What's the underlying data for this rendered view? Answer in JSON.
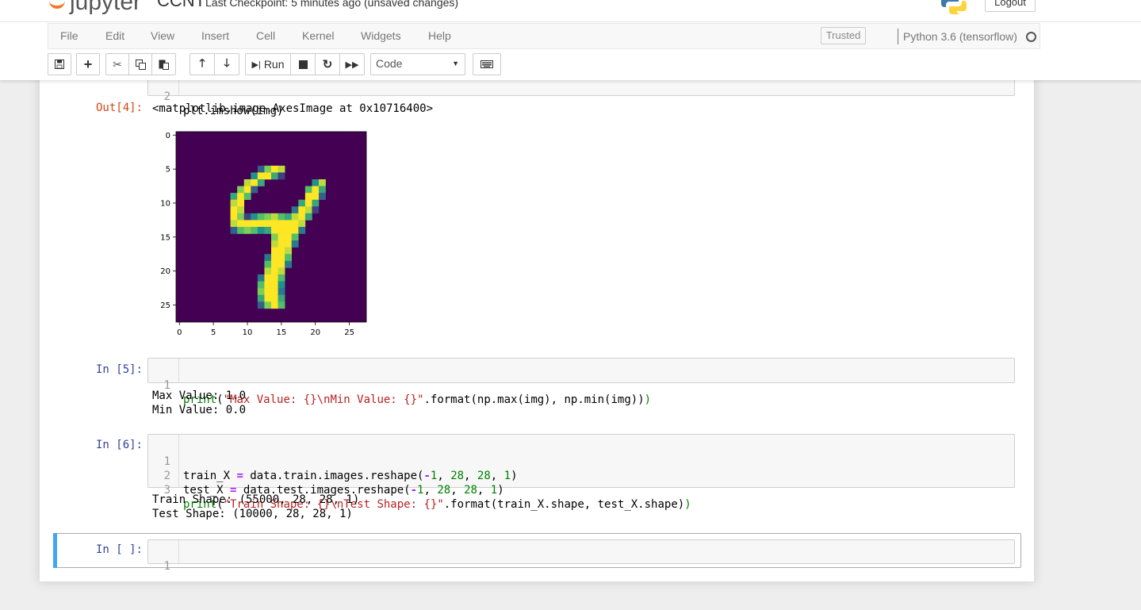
{
  "header": {
    "logo_text": "jupyter",
    "notebook_name": "CCNT",
    "checkpoint": "Last Checkpoint: 5 minutes ago  (unsaved changes)",
    "logout_label": "Logout"
  },
  "menu": {
    "items": [
      "File",
      "Edit",
      "View",
      "Insert",
      "Cell",
      "Kernel",
      "Widgets",
      "Help"
    ],
    "trusted_label": "Trusted",
    "kernel_name": "Python 3.6 (tensorflow)"
  },
  "toolbar": {
    "run_label": "Run",
    "cell_type": "Code",
    "icons": [
      "save-icon",
      "plus-icon",
      "cut-icon",
      "copy-icon",
      "paste-icon",
      "arrow-up-icon",
      "arrow-down-icon",
      "run-icon",
      "stop-icon",
      "restart-icon",
      "fast-forward-icon",
      "keyboard-icon"
    ]
  },
  "cells": {
    "c4": {
      "line2_num": "2",
      "line2_code": "plt.imshow(img)",
      "out_prompt": "Out[4]:",
      "out_text": "<matplotlib.image.AxesImage at 0x10716400>"
    },
    "c5": {
      "prompt": "In [5]:",
      "line1_num": "1",
      "output_line1": "Max Value: 1.0",
      "output_line2": "Min Value: 0.0"
    },
    "c6": {
      "prompt": "In [6]:",
      "line_nums": [
        "1",
        "2",
        "3"
      ],
      "output_line1": "Train Shape: (55000, 28, 28, 1)",
      "output_line2": "Test Shape: (10000, 28, 28, 1)"
    },
    "c7": {
      "prompt": "In [ ]:",
      "line1_num": "1"
    }
  },
  "chart_data": {
    "type": "heatmap",
    "title": "",
    "xlabel": "",
    "ylabel": "",
    "x_ticks": [
      "0",
      "5",
      "10",
      "15",
      "20",
      "25"
    ],
    "y_ticks": [
      "0",
      "5",
      "10",
      "15",
      "20",
      "25"
    ],
    "xlim": [
      -0.5,
      27.5
    ],
    "ylim": [
      27.5,
      -0.5
    ],
    "colormap": "viridis",
    "background_color": "#440154",
    "vmin": 0.0,
    "vmax": 1.0,
    "description_of_values": "28x28 grayscale MNIST digit 4; nonzero pixels listed as [row, col, value]",
    "pixels": [
      [
        5,
        12,
        0.3
      ],
      [
        5,
        13,
        0.8
      ],
      [
        5,
        14,
        1.0
      ],
      [
        5,
        15,
        0.9
      ],
      [
        6,
        11,
        0.5
      ],
      [
        6,
        12,
        1.0
      ],
      [
        6,
        13,
        1.0
      ],
      [
        6,
        14,
        0.6
      ],
      [
        6,
        15,
        0.2
      ],
      [
        7,
        10,
        0.9
      ],
      [
        7,
        11,
        1.0
      ],
      [
        7,
        12,
        0.6
      ],
      [
        7,
        20,
        0.5
      ],
      [
        7,
        21,
        0.9
      ],
      [
        8,
        9,
        0.8
      ],
      [
        8,
        10,
        1.0
      ],
      [
        8,
        11,
        0.3
      ],
      [
        8,
        19,
        0.7
      ],
      [
        8,
        20,
        1.0
      ],
      [
        8,
        21,
        0.6
      ],
      [
        9,
        8,
        0.6
      ],
      [
        9,
        9,
        1.0
      ],
      [
        9,
        10,
        0.7
      ],
      [
        9,
        19,
        1.0
      ],
      [
        9,
        20,
        1.0
      ],
      [
        9,
        21,
        0.3
      ],
      [
        10,
        8,
        0.9
      ],
      [
        10,
        9,
        1.0
      ],
      [
        10,
        18,
        0.6
      ],
      [
        10,
        19,
        1.0
      ],
      [
        10,
        20,
        0.6
      ],
      [
        11,
        8,
        1.0
      ],
      [
        11,
        9,
        0.9
      ],
      [
        11,
        17,
        0.4
      ],
      [
        11,
        18,
        1.0
      ],
      [
        11,
        19,
        0.9
      ],
      [
        11,
        20,
        0.2
      ],
      [
        12,
        8,
        1.0
      ],
      [
        12,
        9,
        0.8
      ],
      [
        12,
        10,
        0.2
      ],
      [
        12,
        11,
        0.5
      ],
      [
        12,
        12,
        0.7
      ],
      [
        12,
        13,
        0.8
      ],
      [
        12,
        14,
        0.9
      ],
      [
        12,
        15,
        0.7
      ],
      [
        12,
        16,
        0.6
      ],
      [
        12,
        17,
        0.9
      ],
      [
        12,
        18,
        1.0
      ],
      [
        12,
        19,
        0.6
      ],
      [
        13,
        8,
        0.9
      ],
      [
        13,
        9,
        1.0
      ],
      [
        13,
        10,
        1.0
      ],
      [
        13,
        11,
        1.0
      ],
      [
        13,
        12,
        1.0
      ],
      [
        13,
        13,
        1.0
      ],
      [
        13,
        14,
        1.0
      ],
      [
        13,
        15,
        1.0
      ],
      [
        13,
        16,
        1.0
      ],
      [
        13,
        17,
        1.0
      ],
      [
        13,
        18,
        0.9
      ],
      [
        14,
        8,
        0.3
      ],
      [
        14,
        9,
        0.7
      ],
      [
        14,
        10,
        0.8
      ],
      [
        14,
        11,
        0.7
      ],
      [
        14,
        12,
        0.5
      ],
      [
        14,
        13,
        0.6
      ],
      [
        14,
        14,
        1.0
      ],
      [
        14,
        15,
        1.0
      ],
      [
        14,
        16,
        1.0
      ],
      [
        14,
        17,
        1.0
      ],
      [
        14,
        18,
        0.4
      ],
      [
        15,
        14,
        0.8
      ],
      [
        15,
        15,
        1.0
      ],
      [
        15,
        16,
        1.0
      ],
      [
        15,
        17,
        0.7
      ],
      [
        16,
        14,
        0.9
      ],
      [
        16,
        15,
        1.0
      ],
      [
        16,
        16,
        1.0
      ],
      [
        16,
        17,
        0.4
      ],
      [
        17,
        14,
        1.0
      ],
      [
        17,
        15,
        1.0
      ],
      [
        17,
        16,
        0.9
      ],
      [
        18,
        13,
        0.4
      ],
      [
        18,
        14,
        1.0
      ],
      [
        18,
        15,
        1.0
      ],
      [
        18,
        16,
        0.7
      ],
      [
        19,
        13,
        0.7
      ],
      [
        19,
        14,
        1.0
      ],
      [
        19,
        15,
        1.0
      ],
      [
        19,
        16,
        0.4
      ],
      [
        20,
        13,
        0.9
      ],
      [
        20,
        14,
        1.0
      ],
      [
        20,
        15,
        0.9
      ],
      [
        21,
        12,
        0.4
      ],
      [
        21,
        13,
        1.0
      ],
      [
        21,
        14,
        1.0
      ],
      [
        21,
        15,
        0.7
      ],
      [
        22,
        12,
        0.7
      ],
      [
        22,
        13,
        1.0
      ],
      [
        22,
        14,
        1.0
      ],
      [
        22,
        15,
        0.5
      ],
      [
        23,
        12,
        0.8
      ],
      [
        23,
        13,
        1.0
      ],
      [
        23,
        14,
        1.0
      ],
      [
        23,
        15,
        0.4
      ],
      [
        24,
        12,
        0.6
      ],
      [
        24,
        13,
        1.0
      ],
      [
        24,
        14,
        1.0
      ],
      [
        24,
        15,
        0.6
      ],
      [
        25,
        12,
        0.3
      ],
      [
        25,
        13,
        0.8
      ],
      [
        25,
        14,
        1.0
      ],
      [
        25,
        15,
        0.7
      ]
    ]
  }
}
